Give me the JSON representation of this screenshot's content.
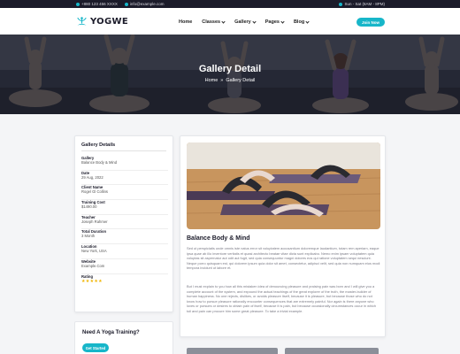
{
  "topbar": {
    "phone": "+880 123 456 XXXX",
    "email": "info@example.com",
    "hours": "Sun - Sat (8AM - 8PM)",
    "icons": [
      "phone-icon",
      "mail-icon",
      "clock-icon"
    ]
  },
  "header": {
    "logo_text": "YOGWE",
    "nav": [
      {
        "label": "Home",
        "has_dropdown": false
      },
      {
        "label": "Classes",
        "has_dropdown": true
      },
      {
        "label": "Gallery",
        "has_dropdown": true
      },
      {
        "label": "Pages",
        "has_dropdown": true
      },
      {
        "label": "Blog",
        "has_dropdown": true
      }
    ],
    "join_label": "Join Now"
  },
  "hero": {
    "title": "Gallery Detail",
    "breadcrumb": [
      "Home",
      "Gallery Detail"
    ],
    "breadcrumb_separator": "»"
  },
  "sidebar": {
    "title": "Gallery Details",
    "items": [
      {
        "label": "Gallery",
        "value": "Balance Body & Mind"
      },
      {
        "label": "Date",
        "value": "29 Aug, 2022"
      },
      {
        "label": "Client Name",
        "value": "Rogel Gl Collins"
      },
      {
        "label": "Training Cost",
        "value": "$1490.00"
      },
      {
        "label": "Teacher",
        "value": "Joseph Rahmer"
      },
      {
        "label": "Total Duration",
        "value": "3 Month"
      },
      {
        "label": "Location",
        "value": "New York, USA"
      },
      {
        "label": "Website",
        "value": "Example.Com"
      },
      {
        "label": "Rating",
        "value": "★★★★★",
        "rating": 5
      }
    ]
  },
  "cta": {
    "title": "Need A Yoga Training?",
    "button_label": "Get Started"
  },
  "main": {
    "title": "Balance Body & Mind",
    "paragraphs": [
      "Sed ut perspiciatis unde omnis iste natus error sit voluptatem accusantium doloremque laudantium, totam rem aperiam, eaque ipsa quae ab illo inventore veritatis et quasi architecto beatae vitae dicta sunt explicabo. Nemo enim ipsam voluptatem quia voluptas sit aspernatur aut odit aut fugit, sed quia consequuntur magni dolores eos qui ratione voluptatem sequi nesciunt. Neque porro quisquam est, qui dolorem ipsum quia dolor sit amet, consectetur, adipisci velit, sed quia non numquam eius modi tempora incidunt ut labore et.",
      "But I must explain to you how all this mistaken idea of denouncing pleasure and praising pain was born and I will give you a complete account of the system, and expound the actual teachings of the great explorer of the truth, the master-builder of human happiness. No one rejects, dislikes, or avoids pleasure itself, because it is pleasure, but because those who do not know how to pursue pleasure rationally encounter consequences that are extremely painful. Nor again is there anyone who loves or pursues or desires to obtain pain of itself, because it is pain, but because occasionally circumstances occur in which toil and pain can procure him some great pleasure. To take a trivial example."
    ]
  },
  "colors": {
    "accent": "#17b6c9",
    "topbar_bg": "#1b1b2a",
    "star": "#f0b400"
  }
}
